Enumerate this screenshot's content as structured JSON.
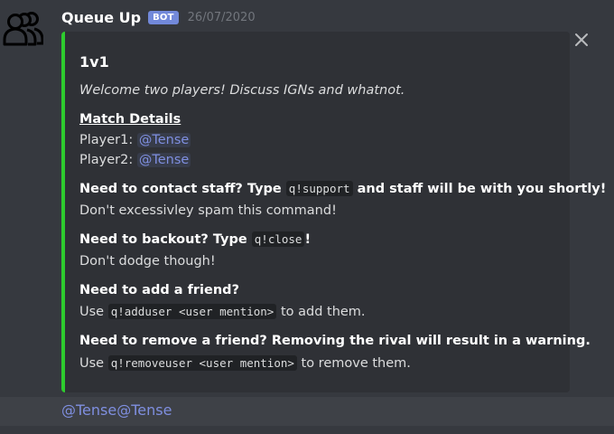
{
  "message": {
    "username": "Queue Up",
    "badge": "BOT",
    "timestamp": "26/07/2020",
    "avatar_icon": "people-group-icon"
  },
  "embed": {
    "accent_color": "#2ecc2e",
    "title": "1v1",
    "description": "Welcome two players! Discuss IGNs and whatnot.",
    "match_details": {
      "heading": "Match Details",
      "player1_label": "Player1:",
      "player1_mention": "@Tense",
      "player2_label": "Player2:",
      "player2_mention": "@Tense"
    },
    "fields": [
      {
        "name_before": "Need to contact staff? Type",
        "name_code": "q!support",
        "name_after": "and staff will be with you shortly!",
        "value": "Don't excessivley spam this command!"
      },
      {
        "name_before": "Need to backout? Type",
        "name_code": "q!close",
        "name_after": "!",
        "value": "Don't dodge though!"
      },
      {
        "name": "Need to add a friend?",
        "value_before": "Use",
        "value_code": "q!adduser <user mention>",
        "value_after": "to add them."
      },
      {
        "name": "Need to remove a friend? Removing the rival will result in a warning.",
        "value_before": "Use",
        "value_code": "q!removeuser <user mention>",
        "value_after": "to remove them."
      }
    ],
    "close_icon": "close-icon"
  },
  "footer": {
    "mentions": "@Tense@Tense"
  }
}
